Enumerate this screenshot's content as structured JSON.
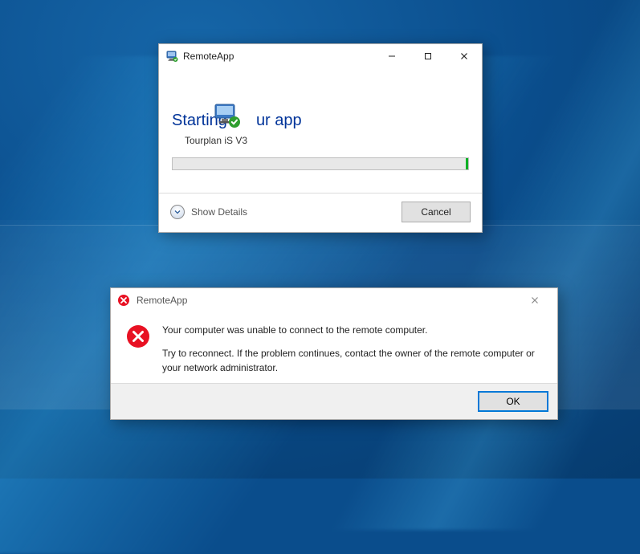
{
  "colors": {
    "link_blue": "#003399",
    "accent_blue": "#0078d7",
    "progress_green": "#06b025",
    "error_red": "#e81123"
  },
  "progress_window": {
    "title": "RemoteApp",
    "title_icon": "remoteapp-icon",
    "heading_prefix": "Starting",
    "heading_suffix": "ur app",
    "app_name": "Tourplan iS V3",
    "show_details_label": "Show Details",
    "cancel_label": "Cancel",
    "controls": {
      "minimize": "minimize-icon",
      "maximize": "maximize-icon",
      "close": "close-icon"
    }
  },
  "error_dialog": {
    "title": "RemoteApp",
    "icon": "error-icon",
    "message_line1": "Your computer was unable to connect to the remote computer.",
    "message_line2": "Try to reconnect. If the problem continues, contact the owner of the remote computer or your network administrator.",
    "ok_label": "OK"
  }
}
